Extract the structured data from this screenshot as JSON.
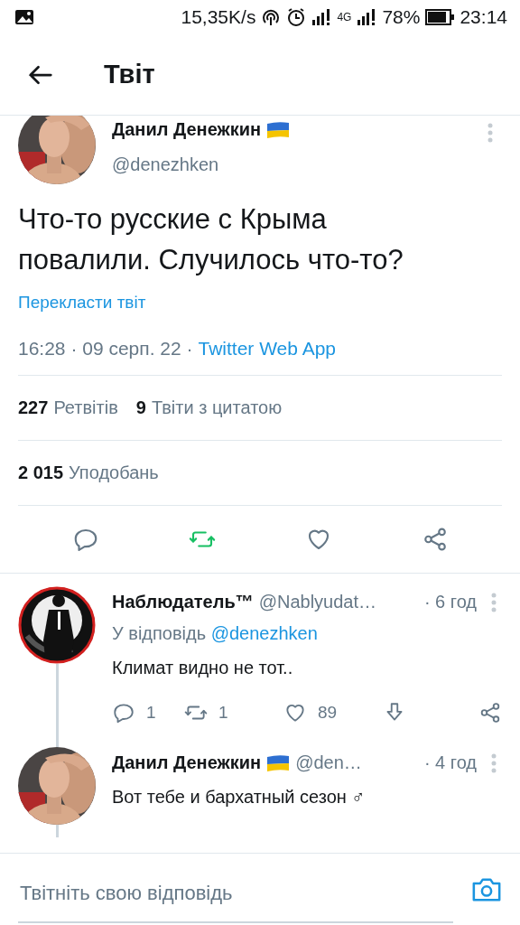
{
  "status_bar": {
    "speed": "15,35K/s",
    "network": "4G",
    "battery": "78%",
    "time": "23:14"
  },
  "header": {
    "title": "Твіт"
  },
  "tweet": {
    "author": "Данил Денежкин",
    "flag": true,
    "handle": "@denezhken",
    "text": "Что-то русские с Крыма повалили. Случилось что-то?",
    "translate": "Перекласти твіт",
    "timestamp": "16:28 · 09 серп. 22 ·",
    "source": "Twitter Web App",
    "stats": [
      {
        "count": "227",
        "label": "Ретвітів"
      },
      {
        "count": "9",
        "label": "Твіти з цитатою"
      }
    ],
    "likes": {
      "count": "2 015",
      "label": "Уподобань"
    },
    "retweeted": true
  },
  "replies": [
    {
      "author": "Наблюдатель™",
      "flag": false,
      "handle": "@Nablyudat…",
      "time": "· 6 год",
      "reply_to_label": "У відповідь",
      "reply_to": "@denezhken",
      "text": "Климат видно не тот..",
      "actions": {
        "replies": "1",
        "retweets": "1",
        "likes": "89"
      }
    },
    {
      "author": "Данил Денежкин",
      "flag": true,
      "handle": "@den…",
      "time": "· 4 год",
      "text": "Вот тебе и бархатный сезон ♂"
    }
  ],
  "reply_box": {
    "placeholder": "Твітніть свою відповідь"
  }
}
